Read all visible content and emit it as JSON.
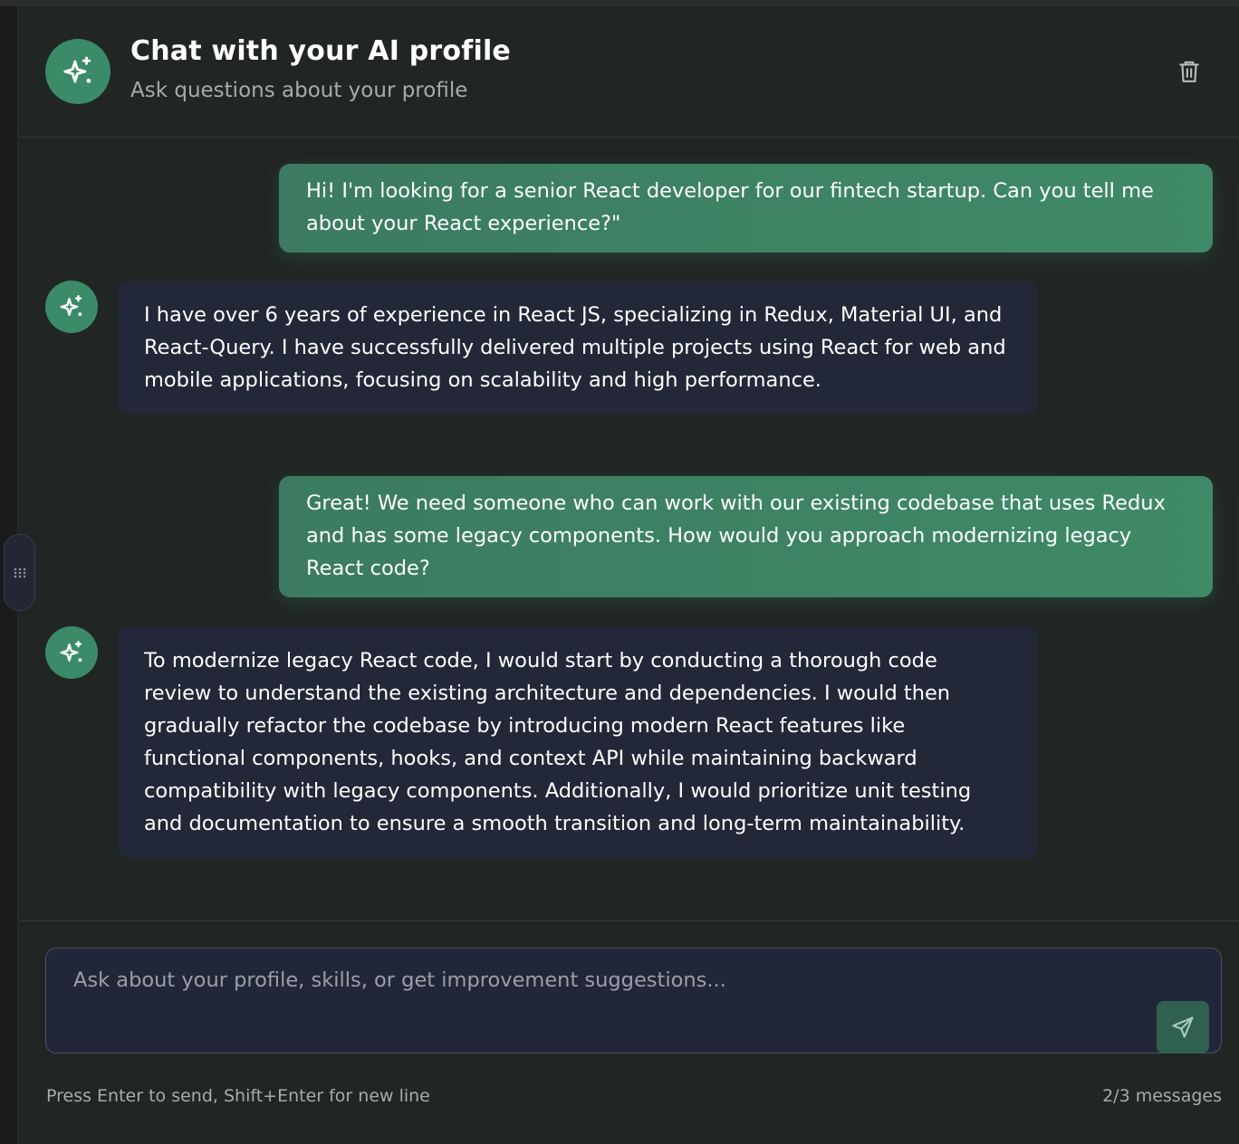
{
  "header": {
    "title": "Chat with your AI profile",
    "subtitle": "Ask questions about your profile",
    "avatar_icon": "sparkles-icon",
    "clear_icon": "trash-icon"
  },
  "messages": [
    {
      "role": "user",
      "text": "Hi! I'm looking for a senior React developer for our fintech startup. Can you tell me about your React experience?\""
    },
    {
      "role": "assistant",
      "text": "I have over 6 years of experience in React JS, specializing in Redux, Material UI, and React-Query. I have successfully delivered multiple projects using React for web and mobile applications, focusing on scalability and high performance."
    },
    {
      "role": "user",
      "text": "Great! We need someone who can work with our existing codebase that uses Redux and has some legacy components. How would you approach modernizing legacy React code?"
    },
    {
      "role": "assistant",
      "text": "To modernize legacy React code, I would start by conducting a thorough code review to understand the existing architecture and dependencies. I would then gradually refactor the codebase by introducing modern React features like functional components, hooks, and context API while maintaining backward compatibility with legacy components. Additionally, I would prioritize unit testing and documentation to ensure a smooth transition and long-term maintainability."
    }
  ],
  "composer": {
    "placeholder": "Ask about your profile, skills, or get improvement suggestions...",
    "value": "",
    "send_icon": "send-icon"
  },
  "footer": {
    "hint": "Press Enter to send, Shift+Enter for new line",
    "message_count": "2/3 messages"
  },
  "colors": {
    "background": "#212524",
    "accent": "#3b8a68",
    "user_bubble": "#3f8a67",
    "assistant_bubble": "#222838",
    "muted_text": "#a6acab"
  }
}
